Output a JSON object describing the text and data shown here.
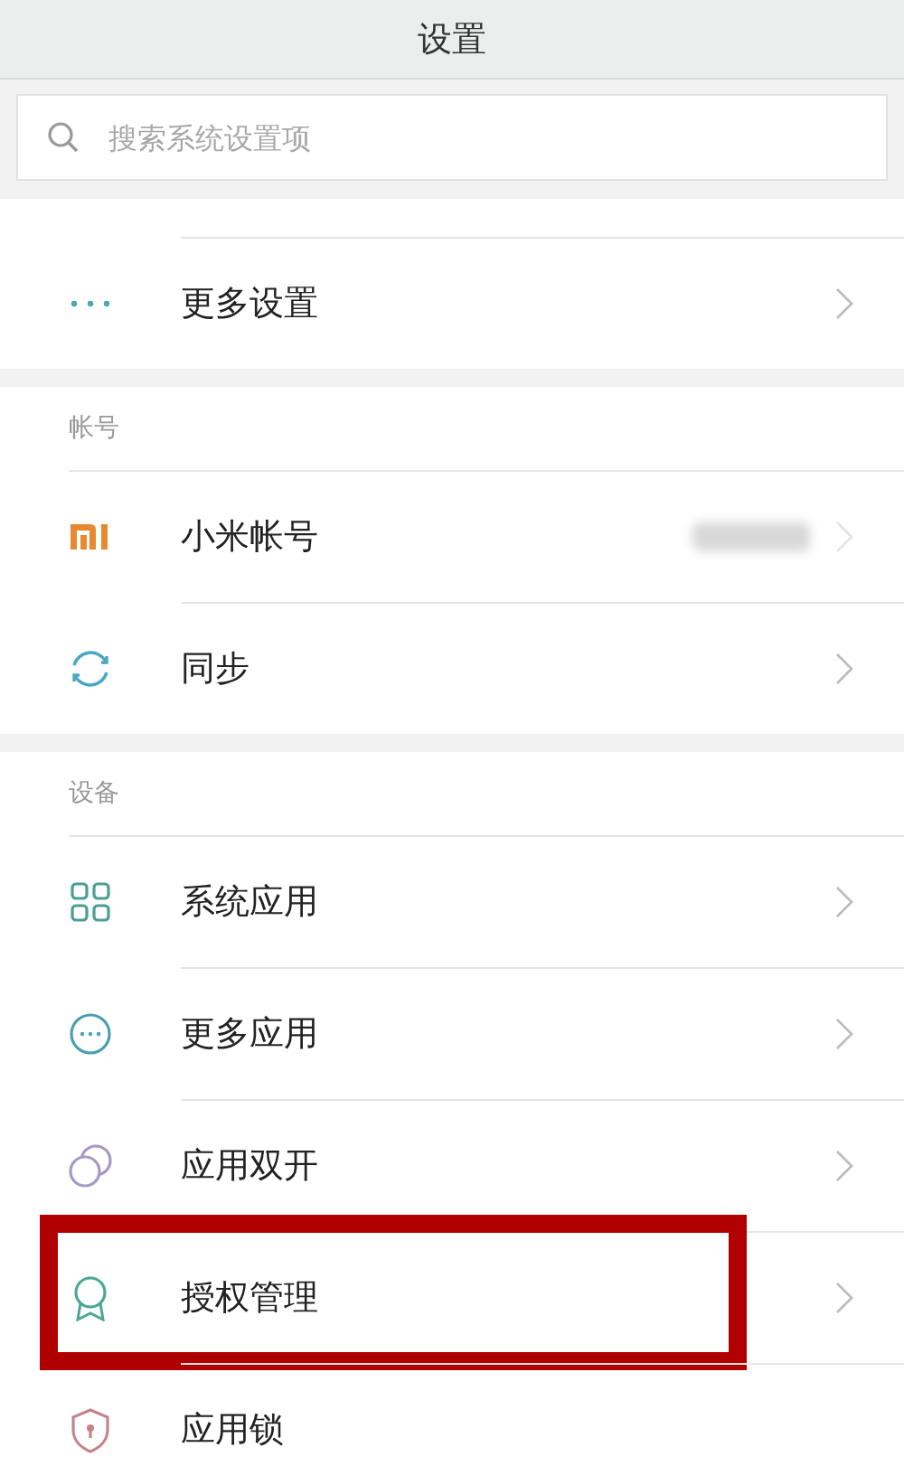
{
  "title": "设置",
  "search": {
    "placeholder": "搜索系统设置项"
  },
  "sections": [
    {
      "items": [
        {
          "label": "更多设置",
          "kind": "dots",
          "chevron": true,
          "redacted": false,
          "highlighted": false
        }
      ]
    },
    {
      "header": "帐号",
      "items": [
        {
          "label": "小米帐号",
          "kind": "mi",
          "chevron": true,
          "redacted": true,
          "highlighted": false
        },
        {
          "label": "同步",
          "kind": "sync",
          "chevron": true,
          "redacted": false,
          "highlighted": false
        }
      ]
    },
    {
      "header": "设备",
      "items": [
        {
          "label": "系统应用",
          "kind": "grid",
          "chevron": true,
          "redacted": false,
          "highlighted": false
        },
        {
          "label": "更多应用",
          "kind": "more",
          "chevron": true,
          "redacted": false,
          "highlighted": false
        },
        {
          "label": "应用双开",
          "kind": "dual",
          "chevron": true,
          "redacted": false,
          "highlighted": false
        },
        {
          "label": "授权管理",
          "kind": "badge",
          "chevron": true,
          "redacted": false,
          "highlighted": true
        },
        {
          "label": "应用锁",
          "kind": "shield",
          "chevron": false,
          "redacted": false,
          "highlighted": false
        }
      ]
    }
  ]
}
